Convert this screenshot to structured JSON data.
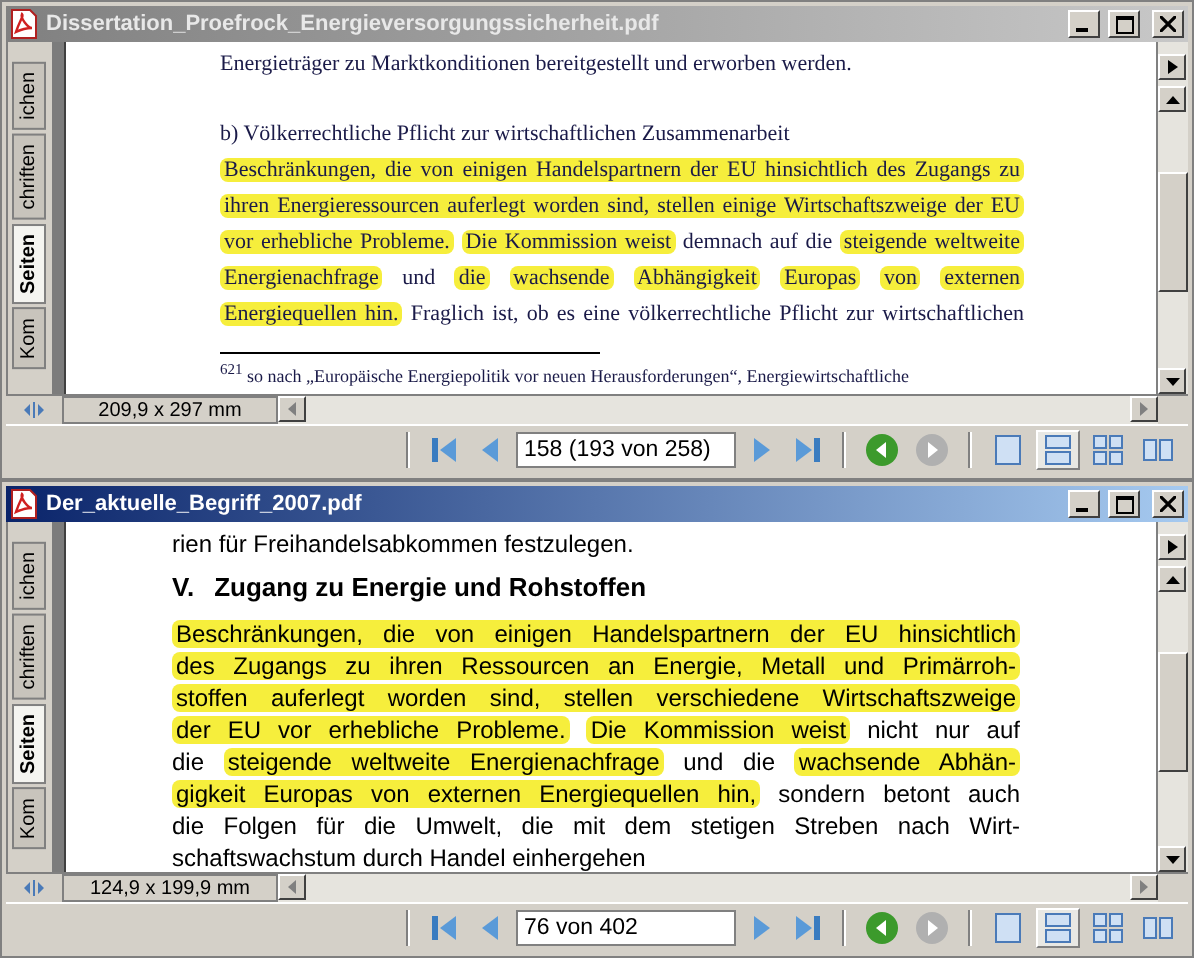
{
  "windows": [
    {
      "title": "Dissertation_Proefrock_Energieversorgungssicherheit.pdf",
      "active": false,
      "side_tabs": [
        {
          "label": "ichen",
          "selected": false
        },
        {
          "label": "chriften",
          "selected": false
        },
        {
          "label": "Seiten",
          "selected": true
        },
        {
          "label": "Kom",
          "selected": false
        }
      ],
      "document": {
        "kind": "serif",
        "lines": [
          {
            "kind": "plain",
            "segments": [
              {
                "text": "Energieträger zu Marktkonditionen bereitgestellt und erworben werden.",
                "highlighted": false
              }
            ]
          },
          {
            "kind": "subheading",
            "segments": [
              {
                "text": "b) Völkerrechtliche Pflicht zur wirtschaftlichen Zusammenarbeit",
                "highlighted": false
              }
            ]
          },
          {
            "kind": "justified",
            "segments": [
              {
                "text": "Beschränkungen, die von einigen Handelspartnern der EU hinsichtlich des Zugangs zu",
                "highlighted": true
              }
            ]
          },
          {
            "kind": "justified",
            "segments": [
              {
                "text": "ihren Energieressourcen auferlegt worden sind, stellen einige Wirtschaftszweige der EU",
                "highlighted": true
              }
            ]
          },
          {
            "kind": "justified",
            "segments": [
              {
                "text": "vor erhebliche Probleme.",
                "highlighted": true
              },
              {
                "text": "Die Kommission weist",
                "highlighted": true
              },
              {
                "text": "demnach auf die",
                "highlighted": false
              },
              {
                "text": "steigende weltweite",
                "highlighted": true
              }
            ]
          },
          {
            "kind": "justified",
            "segments": [
              {
                "text": "Energienachfrage",
                "highlighted": true
              },
              {
                "text": "und",
                "highlighted": false
              },
              {
                "text": "die",
                "highlighted": true
              },
              {
                "text": "wachsende",
                "highlighted": true
              },
              {
                "text": "Abhängigkeit",
                "highlighted": true
              },
              {
                "text": "Europas",
                "highlighted": true
              },
              {
                "text": "von",
                "highlighted": true
              },
              {
                "text": "externen",
                "highlighted": true
              }
            ]
          },
          {
            "kind": "justified",
            "segments": [
              {
                "text": "Energiequellen hin.",
                "highlighted": true
              },
              {
                "text": "Fraglich ist, ob es eine völkerrechtliche Pflicht zur wirtschaftlichen",
                "highlighted": false
              }
            ]
          },
          {
            "kind": "footnote",
            "segments": [
              {
                "text": "$^{621}$ so nach „Europäische Energiepolitik vor neuen Herausforderungen“, Energiewirtschaftliche",
                "highlighted": false
              }
            ]
          }
        ]
      },
      "page_size": "209,9 x 297 mm",
      "page_field": "158 (193 von 258)",
      "history": [
        {
          "kind": "back",
          "disabled": false
        },
        {
          "kind": "forward",
          "disabled": true
        }
      ],
      "views": [
        {
          "kind": "single",
          "selected": false
        },
        {
          "kind": "continuous",
          "selected": true
        },
        {
          "kind": "facing-continuous",
          "selected": false
        },
        {
          "kind": "facing",
          "selected": false
        }
      ]
    },
    {
      "title": "Der_aktuelle_Begriff_2007.pdf",
      "active": true,
      "side_tabs": [
        {
          "label": "ichen",
          "selected": false
        },
        {
          "label": "chriften",
          "selected": false
        },
        {
          "label": "Seiten",
          "selected": true
        },
        {
          "label": "Kom",
          "selected": false
        }
      ],
      "document": {
        "kind": "sans",
        "lines": [
          {
            "kind": "plain",
            "segments": [
              {
                "text": "rien für Freihandelsabkommen festzulegen.",
                "highlighted": false
              }
            ]
          },
          {
            "kind": "heading",
            "number": "V.",
            "segments": [
              {
                "text": "Zugang zu Energie und Rohstoffen",
                "highlighted": false
              }
            ]
          },
          {
            "kind": "justified",
            "segments": [
              {
                "text": "Beschränkungen, die von einigen Handelspartnern der EU hinsichtlich",
                "highlighted": true
              }
            ]
          },
          {
            "kind": "justified",
            "segments": [
              {
                "text": "des Zugangs zu ihren Ressourcen an Energie, Metall und Primärroh-",
                "highlighted": true
              }
            ]
          },
          {
            "kind": "justified",
            "segments": [
              {
                "text": "stoffen auferlegt worden sind, stellen verschiedene Wirtschaftszweige",
                "highlighted": true
              }
            ]
          },
          {
            "kind": "justified",
            "segments": [
              {
                "text": "der EU vor erhebliche Probleme.",
                "highlighted": true
              },
              {
                "text": "Die Kommission weist",
                "highlighted": true
              },
              {
                "text": "nicht nur auf",
                "highlighted": false
              }
            ]
          },
          {
            "kind": "justified",
            "segments": [
              {
                "text": "die",
                "highlighted": false
              },
              {
                "text": "steigende weltweite Energienachfrage",
                "highlighted": true
              },
              {
                "text": "und die",
                "highlighted": false
              },
              {
                "text": "wachsende Abhän-",
                "highlighted": true
              }
            ]
          },
          {
            "kind": "justified",
            "segments": [
              {
                "text": "gigkeit Europas von externen Energiequellen hin,",
                "highlighted": true
              },
              {
                "text": "sondern betont auch",
                "highlighted": false
              }
            ]
          },
          {
            "kind": "justified",
            "segments": [
              {
                "text": "die Folgen für die Umwelt, die mit dem stetigen Streben nach Wirt-",
                "highlighted": false
              }
            ]
          },
          {
            "kind": "plain",
            "segments": [
              {
                "text": "schaftswachstum durch Handel einhergehen",
                "highlighted": false
              }
            ]
          }
        ]
      },
      "page_size": "124,9 x 199,9 mm",
      "page_field": "76 von 402",
      "history": [
        {
          "kind": "back",
          "disabled": false
        },
        {
          "kind": "forward",
          "disabled": true
        }
      ],
      "views": [
        {
          "kind": "single",
          "selected": false
        },
        {
          "kind": "continuous",
          "selected": true
        },
        {
          "kind": "facing-continuous",
          "selected": false
        },
        {
          "kind": "facing",
          "selected": false
        }
      ]
    }
  ]
}
